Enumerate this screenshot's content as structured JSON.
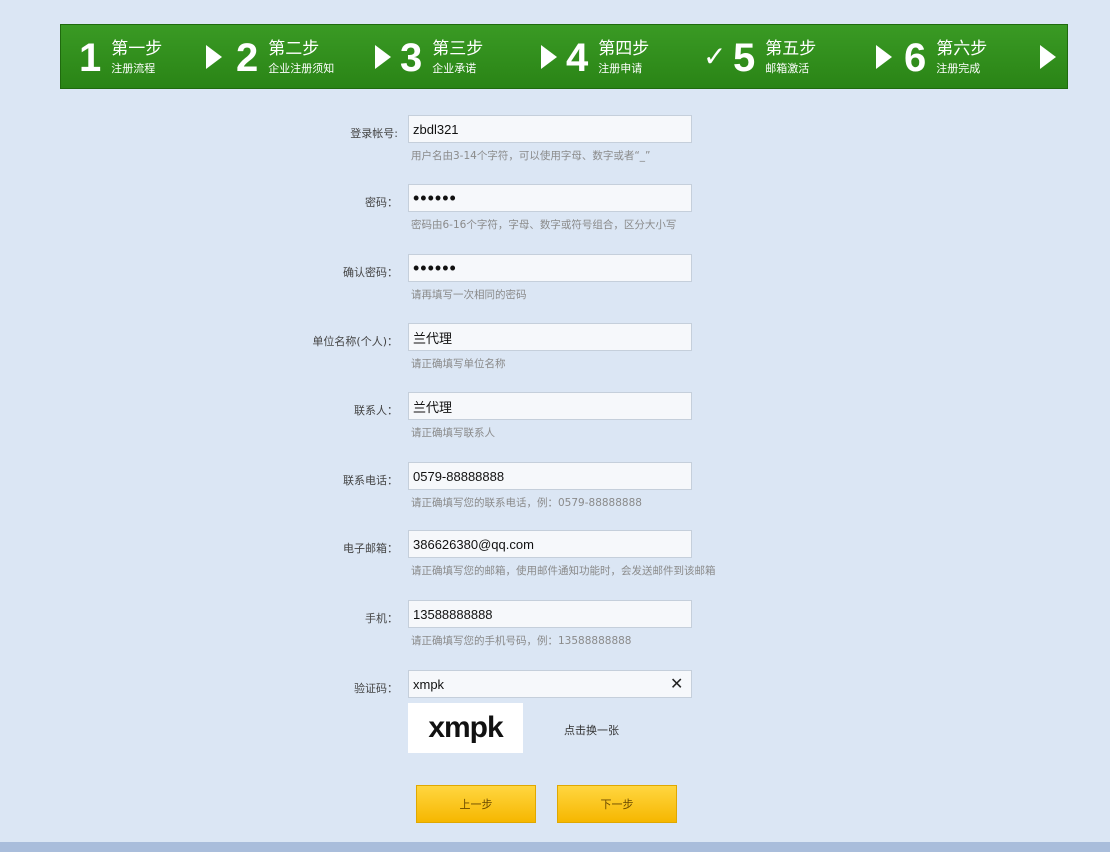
{
  "steps": [
    {
      "num": "1",
      "title": "第一步",
      "sub": "注册流程"
    },
    {
      "num": "2",
      "title": "第二步",
      "sub": "企业注册须知"
    },
    {
      "num": "3",
      "title": "第三步",
      "sub": "企业承诺"
    },
    {
      "num": "4",
      "title": "第四步",
      "sub": "注册申请"
    },
    {
      "num": "5",
      "title": "第五步",
      "sub": "邮箱激活"
    },
    {
      "num": "6",
      "title": "第六步",
      "sub": "注册完成"
    }
  ],
  "colors": {
    "stepbar": "#2f8f1c",
    "button": "#f8c41a",
    "background": "#dbe6f4"
  },
  "form": {
    "account": {
      "label": "登录帐号:",
      "value": "zbdl321",
      "hint": "用户名由3-14个字符，可以使用字母、数字或者“_”"
    },
    "password": {
      "label": "密码：",
      "value": "••••••",
      "hint": "密码由6-16个字符，字母、数字或符号组合，区分大小写"
    },
    "confirm": {
      "label": "确认密码：",
      "value": "••••••",
      "hint": "请再填写一次相同的密码"
    },
    "org": {
      "label": "单位名称(个人)：",
      "value": "兰代理",
      "hint": "请正确填写单位名称"
    },
    "contact": {
      "label": "联系人：",
      "value": "兰代理",
      "hint": "请正确填写联系人"
    },
    "phone": {
      "label": "联系电话：",
      "value": "0579-88888888",
      "hint": "请正确填写您的联系电话，例：0579-88888888"
    },
    "email": {
      "label": "电子邮箱：",
      "value": "386626380@qq.com",
      "hint": "请正确填写您的邮箱，使用邮件通知功能时，会发送邮件到该邮箱"
    },
    "mobile": {
      "label": "手机：",
      "value": "13588888888",
      "hint": "请正确填写您的手机号码，例：13588888888"
    },
    "captcha": {
      "label": "验证码：",
      "value": "xmpk",
      "image_text": "xmpk",
      "refresh": "点击换一张",
      "clear_icon": "close-icon"
    }
  },
  "buttons": {
    "prev": "上一步",
    "next": "下一步"
  }
}
